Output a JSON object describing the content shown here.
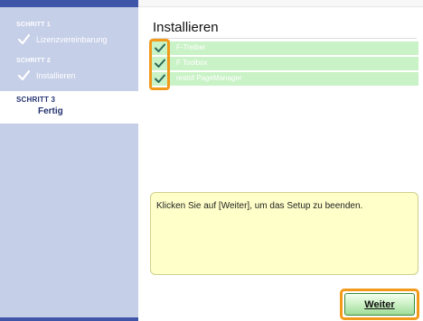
{
  "sidebar": {
    "steps": [
      {
        "number": "SCHRITT 1",
        "name": "Lizenzvereinbarung"
      },
      {
        "number": "SCHRITT 2",
        "name": "Installieren"
      },
      {
        "number": "SCHRITT 3",
        "name": "Fertig"
      }
    ]
  },
  "main": {
    "title": "Installieren",
    "items": [
      {
        "label": "F-Treiber"
      },
      {
        "label": "F Toolbox"
      },
      {
        "label": "restof PageManager"
      }
    ],
    "message": "Klicken Sie auf [Weiter], um das Setup zu beenden.",
    "next_button": "Weiter"
  },
  "colors": {
    "sidebar_bg": "#c6cfe8",
    "sidebar_stripe": "#3f55a8",
    "item_bg": "#c9f2c6",
    "message_bg": "#ffffc9",
    "highlight": "#f29a1a"
  }
}
